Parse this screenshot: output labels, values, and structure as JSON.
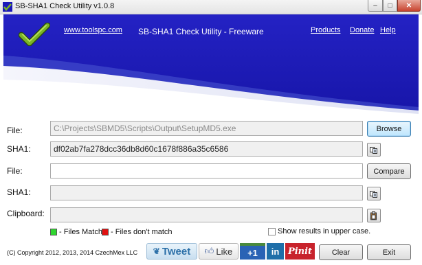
{
  "window": {
    "title": "SB-SHA1 Check Utility  v1.0.8",
    "controls": {
      "minimize": "–",
      "maximize": "□",
      "close": "✕"
    }
  },
  "header": {
    "website": "www.toolspc.com",
    "title": "SB-SHA1 Check Utility - Freeware",
    "links": [
      "Products",
      "Donate",
      "Help"
    ],
    "logo_icon": "checkmark-icon",
    "colors": {
      "header_blue": "#1b19b9",
      "header_light": "#5a66d9",
      "checkmark_green": "#7ab526"
    }
  },
  "form": {
    "file1": {
      "label": "File:",
      "value": "C:\\Projects\\SBMD5\\Scripts\\Output\\SetupMD5.exe",
      "button": "Browse"
    },
    "sha1_1": {
      "label": "SHA1:",
      "value": "df02ab7fa278dcc36db8d60c1678f886a35c6586",
      "icon": "copy-icon"
    },
    "file2": {
      "label": "File:",
      "value": "",
      "button": "Compare"
    },
    "sha1_2": {
      "label": "SHA1:",
      "value": "",
      "icon": "copy-icon"
    },
    "clipboard": {
      "label": "Clipboard:",
      "value": "",
      "icon": "paste-icon"
    }
  },
  "legend": {
    "match": "- Files Match",
    "nomatch": "- Files don't match",
    "colors": {
      "match": "#2fd62f",
      "nomatch": "#e01010"
    }
  },
  "options": {
    "uppercase_label": "Show results in upper case.",
    "uppercase_checked": false
  },
  "footer": {
    "copyright": "(C) Copyright 2012, 2013, 2014 CzechMex LLC",
    "social": {
      "tweet": "Tweet",
      "like": "Like",
      "plus": "+1",
      "linkedin": "in",
      "pinit": "Pinit"
    },
    "clear": "Clear",
    "exit": "Exit"
  }
}
